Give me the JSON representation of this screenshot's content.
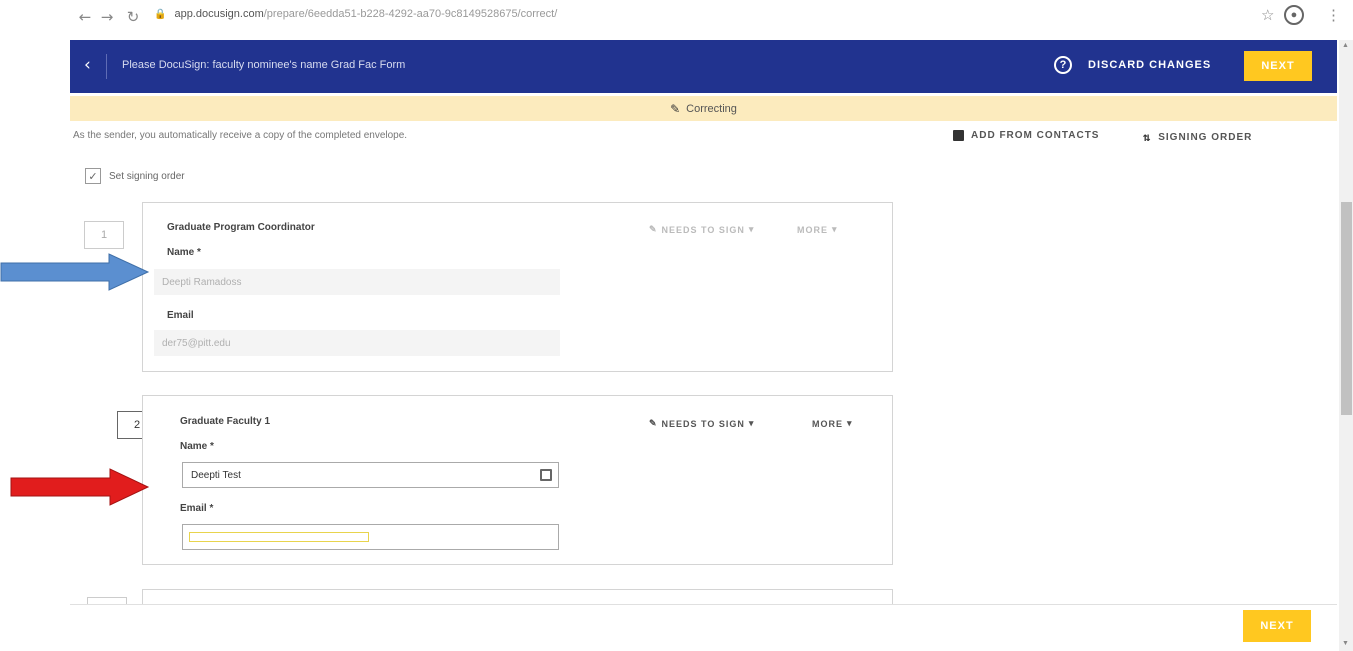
{
  "browser": {
    "url_host": "app.docusign.com",
    "url_path": "/prepare/6eedda51-b228-4292-aa70-9c8149528675/correct/",
    "icons": [
      "back-arrow-icon",
      "forward-arrow-icon",
      "reload-icon",
      "lock-icon",
      "star-icon",
      "profile-icon",
      "kebab-menu-icon"
    ]
  },
  "header": {
    "title": "Please DocuSign: faculty nominee's name Grad Fac Form",
    "help_glyph": "?",
    "discard_label": "DISCARD CHANGES",
    "next_label": "NEXT",
    "background": "#21338f",
    "accent": "#ffc820"
  },
  "banner": {
    "label": "Correcting",
    "background": "#fcebbe"
  },
  "toolbar": {
    "sender_note": "As the sender, you automatically receive a copy of the completed envelope.",
    "add_contacts_label": "ADD FROM CONTACTS",
    "signing_order_label": "SIGNING ORDER",
    "set_signing_order_label": "Set signing order",
    "set_signing_order_checked": true
  },
  "recipients": [
    {
      "order": "1",
      "role": "Graduate Program Coordinator",
      "action_label": "NEEDS TO SIGN",
      "more_label": "MORE",
      "name_label": "Name *",
      "name_value": "Deepti Ramadoss",
      "email_label": "Email",
      "email_value": "der75@pitt.edu",
      "editable": false
    },
    {
      "order": "2",
      "role": "Graduate Faculty 1",
      "action_label": "NEEDS TO SIGN",
      "more_label": "MORE",
      "name_label": "Name *",
      "name_value": "Deepti Test",
      "email_label": "Email *",
      "email_value": "",
      "editable": true
    }
  ],
  "footer": {
    "next_label": "NEXT"
  },
  "annotations": {
    "arrows": [
      {
        "color": "#5b8fd0",
        "target": "Name field of recipient 1"
      },
      {
        "color": "#e11d1d",
        "target": "drag handle of recipient 2"
      }
    ]
  }
}
